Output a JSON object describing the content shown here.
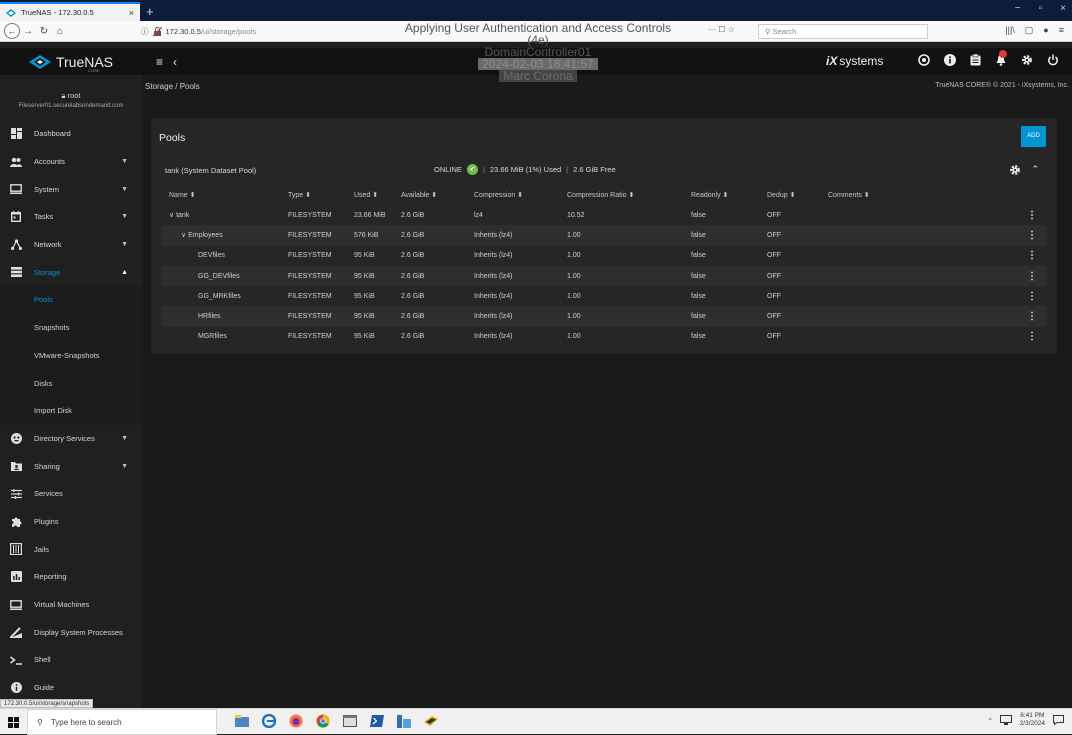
{
  "browser": {
    "tab_title": "TrueNAS - 172.30.0.5",
    "tab_close": "×",
    "new_tab": "+",
    "window_controls": [
      "−",
      "▫",
      "×"
    ],
    "url_host": "172.30.0.5",
    "url_path": "/ui/storage/pools",
    "url_tools": "··· ☐ ☆",
    "search_placeholder": "Search",
    "right_icons": [
      "|||\\",
      "▢",
      "●",
      "≡"
    ]
  },
  "overlay": {
    "line1": "Applying User Authentication and Access Controls (4e)",
    "line2": "DomainController01",
    "line3": "2024-02-03 18:41:57",
    "line4": "Marc Corona"
  },
  "app": {
    "logo_text": "TrueNAS",
    "logo_sub": "CORE",
    "menu_icon": "≡",
    "collapse_icon": "‹",
    "brand": "systems",
    "brand_prefix": "iX"
  },
  "breadcrumb": "Storage  /  Pools",
  "copyright": "TrueNAS CORE® © 2021 - iXsystems, Inc.",
  "user": {
    "name": "root",
    "host": "Fileserver01.securelabsondemand.com"
  },
  "sidebar": {
    "items": [
      {
        "label": "Dashboard",
        "icon": "dashboard-icon",
        "caret": ""
      },
      {
        "label": "Accounts",
        "icon": "accounts-icon",
        "caret": "▼"
      },
      {
        "label": "System",
        "icon": "system-icon",
        "caret": "▼"
      },
      {
        "label": "Tasks",
        "icon": "tasks-icon",
        "caret": "▼"
      },
      {
        "label": "Network",
        "icon": "network-icon",
        "caret": "▼"
      },
      {
        "label": "Storage",
        "icon": "storage-icon",
        "caret": "▲"
      }
    ],
    "storage_sub": [
      "Pools",
      "Snapshots",
      "VMware-Snapshots",
      "Disks",
      "Import Disk"
    ],
    "items2": [
      {
        "label": "Directory Services",
        "icon": "directory-services-icon",
        "caret": "▼"
      },
      {
        "label": "Sharing",
        "icon": "sharing-icon",
        "caret": "▼"
      },
      {
        "label": "Services",
        "icon": "services-icon",
        "caret": ""
      },
      {
        "label": "Plugins",
        "icon": "plugins-icon",
        "caret": ""
      },
      {
        "label": "Jails",
        "icon": "jails-icon",
        "caret": ""
      },
      {
        "label": "Reporting",
        "icon": "reporting-icon",
        "caret": ""
      },
      {
        "label": "Virtual Machines",
        "icon": "virtual-machines-icon",
        "caret": ""
      },
      {
        "label": "Display System Processes",
        "icon": "processes-icon",
        "caret": ""
      },
      {
        "label": "Shell",
        "icon": "shell-icon",
        "caret": ""
      },
      {
        "label": "Guide",
        "icon": "guide-icon",
        "caret": ""
      }
    ]
  },
  "pools": {
    "title": "Pools",
    "add_label": "ADD",
    "pool_name": "tank  (System Dataset Pool)",
    "status": "ONLINE",
    "usage": "23.66 MiB (1%) Used",
    "free": "2.6 GiB Free",
    "separator": "|",
    "columns": [
      "Name ⬍",
      "Type ⬍",
      "Used ⬍",
      "Available ⬍",
      "Compression ⬍",
      "Compression Ratio ⬍",
      "Readonly ⬍",
      "Dedup ⬍",
      "Comments ⬍"
    ],
    "rows": [
      {
        "name": "∨ tank",
        "level": 0,
        "type": "FILESYSTEM",
        "used": "23.66 MiB",
        "avail": "2.6 GiB",
        "comp": "lz4",
        "ratio": "10.52",
        "ro": "false",
        "dedup": "OFF",
        "comments": ""
      },
      {
        "name": "∨ Employees",
        "level": 1,
        "type": "FILESYSTEM",
        "used": "576 KiB",
        "avail": "2.6 GiB",
        "comp": "Inherits (lz4)",
        "ratio": "1.00",
        "ro": "false",
        "dedup": "OFF",
        "comments": ""
      },
      {
        "name": "DEVfiles",
        "level": 2,
        "type": "FILESYSTEM",
        "used": "95 KiB",
        "avail": "2.6 GiB",
        "comp": "Inherits (lz4)",
        "ratio": "1.00",
        "ro": "false",
        "dedup": "OFF",
        "comments": ""
      },
      {
        "name": "GG_DEVfiles",
        "level": 2,
        "type": "FILESYSTEM",
        "used": "95 KiB",
        "avail": "2.6 GiB",
        "comp": "Inherits (lz4)",
        "ratio": "1.00",
        "ro": "false",
        "dedup": "OFF",
        "comments": ""
      },
      {
        "name": "GG_MRKfiles",
        "level": 2,
        "type": "FILESYSTEM",
        "used": "95 KiB",
        "avail": "2.6 GiB",
        "comp": "Inherits (lz4)",
        "ratio": "1.00",
        "ro": "false",
        "dedup": "OFF",
        "comments": ""
      },
      {
        "name": "HRfiles",
        "level": 2,
        "type": "FILESYSTEM",
        "used": "95 KiB",
        "avail": "2.6 GiB",
        "comp": "Inherits (lz4)",
        "ratio": "1.00",
        "ro": "false",
        "dedup": "OFF",
        "comments": ""
      },
      {
        "name": "MGRfiles",
        "level": 2,
        "type": "FILESYSTEM",
        "used": "95 KiB",
        "avail": "2.6 GiB",
        "comp": "Inherits (lz4)",
        "ratio": "1.00",
        "ro": "false",
        "dedup": "OFF",
        "comments": ""
      }
    ]
  },
  "statusbar_url": "172.30.0.5/ui/storage/snapshots",
  "taskbar": {
    "search_placeholder": "Type here to search",
    "time": "6:41 PM",
    "date": "2/3/2024"
  },
  "colors": {
    "accent": "#0095d5",
    "online": "#71bf44",
    "alert": "#e53935"
  }
}
